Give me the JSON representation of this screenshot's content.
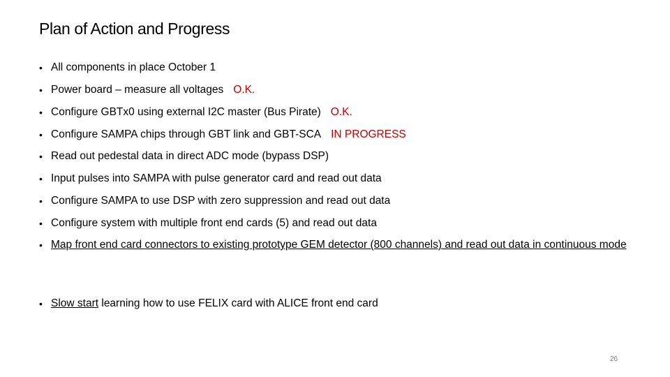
{
  "slide": {
    "title": "Plan of Action and Progress",
    "bullets": [
      {
        "text": "All components in place October 1",
        "status": ""
      },
      {
        "text": "Power board – measure all voltages",
        "status": "O.K."
      },
      {
        "text": "Configure GBTx0 using external I2C master (Bus Pirate)",
        "status": "O.K."
      },
      {
        "text": "Configure SAMPA chips through GBT link and GBT-SCA",
        "status": "IN PROGRESS"
      },
      {
        "text": "Read out pedestal data in direct ADC mode (bypass DSP)",
        "status": ""
      },
      {
        "text": "Input pulses into SAMPA with pulse generator card and read out data",
        "status": ""
      },
      {
        "text": "Configure SAMPA to use DSP with zero suppression and read out data",
        "status": ""
      },
      {
        "text": "Configure system with multiple front end cards (5) and read out data",
        "status": ""
      },
      {
        "text": "Map front end card connectors to existing prototype GEM detector (800 channels) and read out data in continuous mode",
        "status": "",
        "underlined": true
      },
      {
        "underlined_part": "Slow start",
        "text": " learning how to use FELIX card with ALICE front end card",
        "status": ""
      }
    ],
    "bullet_glyph": "•",
    "status_color": "#c00000",
    "page_number": "26"
  }
}
